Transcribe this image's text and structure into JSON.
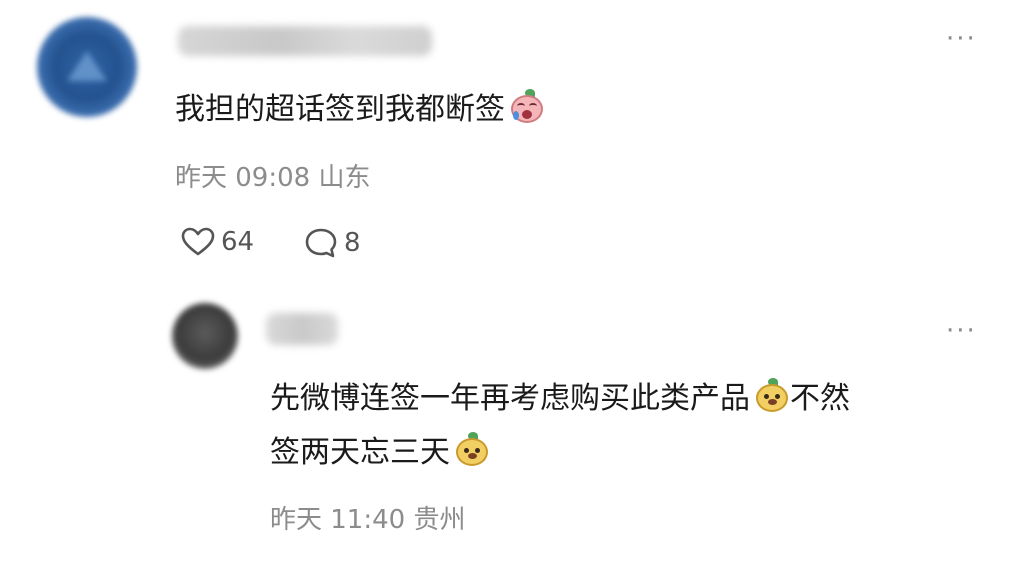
{
  "comment": {
    "text": "我担的超话签到我都断签",
    "emoji": "crying-peach-emoji",
    "time": "昨天 09:08",
    "location": "山东",
    "likes": "64",
    "replies": "8",
    "more_label": "···"
  },
  "reply_comment": {
    "text_line1": "先微博连签一年再考虑购买此类产品",
    "text_line1_tail": "不然",
    "text_line2": "签两天忘三天",
    "emoji": "happy-dog-emoji",
    "time": "昨天 11:40",
    "location": "贵州",
    "more_label": "···"
  },
  "colors": {
    "text": "#1a1a1a",
    "meta": "#8c8c8c",
    "icon": "#555555"
  }
}
